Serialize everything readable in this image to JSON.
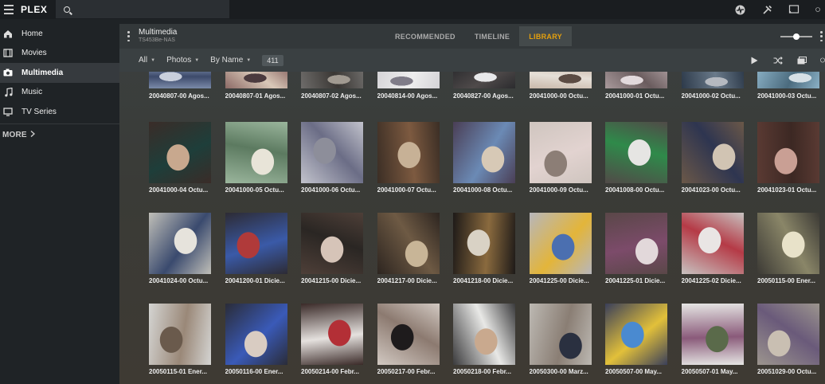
{
  "app": {
    "logo_text": "PLEX",
    "brand_color": "#e5a00d"
  },
  "sidebar": {
    "items": [
      {
        "label": "Home",
        "icon": "home-icon"
      },
      {
        "label": "Movies",
        "icon": "film-icon"
      },
      {
        "label": "Multimedia",
        "icon": "camera-icon",
        "active": true
      },
      {
        "label": "Music",
        "icon": "music-note-icon"
      },
      {
        "label": "TV Series",
        "icon": "tv-icon"
      }
    ],
    "more_label": "MORE"
  },
  "header": {
    "library_title": "Multimedia",
    "library_subtitle": "TS453Be-NAS",
    "tabs": [
      {
        "label": "RECOMMENDED"
      },
      {
        "label": "TIMELINE"
      },
      {
        "label": "LIBRARY",
        "active": true
      }
    ]
  },
  "filters": {
    "type": "All",
    "media": "Photos",
    "sort": "By Name",
    "count": "411"
  },
  "tiles": [
    {
      "caption": "20040807-00 Agos...",
      "colors": [
        "#7a8aa8",
        "#c9cfdc",
        "#3d4a6b"
      ]
    },
    {
      "caption": "20040807-01 Agos...",
      "colors": [
        "#8c6a66",
        "#4b3a3e",
        "#d9c8b8"
      ]
    },
    {
      "caption": "20040807-02 Agos...",
      "colors": [
        "#6e6c6a",
        "#a19a91",
        "#3a3734"
      ]
    },
    {
      "caption": "20040814-00 Agos...",
      "colors": [
        "#d4d3d6",
        "#7f7c88",
        "#eeeeee"
      ]
    },
    {
      "caption": "20040827-00 Agos...",
      "colors": [
        "#2b2b2e",
        "#e8e8ea",
        "#4f4a4a"
      ]
    },
    {
      "caption": "20041000-00 Octu...",
      "colors": [
        "#c9b8aa",
        "#5b4b43",
        "#e5dfd7"
      ]
    },
    {
      "caption": "20041000-01 Octu...",
      "colors": [
        "#a99a9c",
        "#e2d9dc",
        "#6a5c5e"
      ]
    },
    {
      "caption": "20041000-02 Octu...",
      "colors": [
        "#2d3a4a",
        "#b5b9c0",
        "#6a7a8a"
      ]
    },
    {
      "caption": "20041000-03 Octu...",
      "colors": [
        "#8ab0c5",
        "#d6e0e6",
        "#4b6b7e"
      ]
    },
    {
      "caption": "20041000-04 Octu...",
      "colors": [
        "#3a2c28",
        "#c8a88e",
        "#1e3e3a"
      ]
    },
    {
      "caption": "20041000-05 Octu...",
      "colors": [
        "#9ab59c",
        "#e8e4d8",
        "#5c7a60"
      ]
    },
    {
      "caption": "20041000-06 Octu...",
      "colors": [
        "#c2c3cc",
        "#8d8e9a",
        "#6b6d86"
      ]
    },
    {
      "caption": "20041000-07 Octu...",
      "colors": [
        "#3b2e25",
        "#c7b196",
        "#7d5a40"
      ]
    },
    {
      "caption": "20041000-08 Octu...",
      "colors": [
        "#4a3e55",
        "#d7c9b6",
        "#6b8ab5"
      ]
    },
    {
      "caption": "20041000-09 Octu...",
      "colors": [
        "#cfc5bf",
        "#8c7e76",
        "#e2d3d0"
      ]
    },
    {
      "caption": "20041008-00 Octu...",
      "colors": [
        "#514a48",
        "#e6e5e3",
        "#2f8a4a"
      ]
    },
    {
      "caption": "20041023-00 Octu...",
      "colors": [
        "#6b5848",
        "#d1c4b3",
        "#2e3550"
      ]
    },
    {
      "caption": "20041023-01 Octu...",
      "colors": [
        "#5a3a33",
        "#c99f94",
        "#3c2823"
      ]
    },
    {
      "caption": "20041024-00 Octu...",
      "colors": [
        "#c0bfb8",
        "#e6e3dc",
        "#3a4a6e"
      ]
    },
    {
      "caption": "20041200-01 Dicie...",
      "colors": [
        "#2d2b34",
        "#b03a3a",
        "#3a5aa8"
      ]
    },
    {
      "caption": "20041215-00 Dicie...",
      "colors": [
        "#4e3f38",
        "#d6c4b8",
        "#2a2623"
      ]
    },
    {
      "caption": "20041217-00 Dicie...",
      "colors": [
        "#2d2520",
        "#c8b597",
        "#6e5a44"
      ]
    },
    {
      "caption": "20041218-00 Dicie...",
      "colors": [
        "#1e1a18",
        "#d9d2c5",
        "#8a6a3e"
      ]
    },
    {
      "caption": "20041225-00 Dicie...",
      "colors": [
        "#b7b6bb",
        "#4b6fb0",
        "#e3b53a"
      ]
    },
    {
      "caption": "20041225-01 Dicie...",
      "colors": [
        "#5a4748",
        "#e2d8da",
        "#7c4b6a"
      ]
    },
    {
      "caption": "20041225-02 Dicie...",
      "colors": [
        "#c7c2c0",
        "#e9e5e4",
        "#b53a46"
      ]
    },
    {
      "caption": "20050115-00 Ener...",
      "colors": [
        "#3c3a35",
        "#e8e2c9",
        "#8a8668"
      ]
    },
    {
      "caption": "20050115-01 Ener...",
      "colors": [
        "#d4d4d2",
        "#6a5a4c",
        "#9a8878"
      ]
    },
    {
      "caption": "20050116-00 Ener...",
      "colors": [
        "#2a2c38",
        "#d9ccc2",
        "#3a5ab8"
      ]
    },
    {
      "caption": "20050214-00 Febr...",
      "colors": [
        "#3a2a28",
        "#b32f36",
        "#e5e1de"
      ]
    },
    {
      "caption": "20050217-00 Febr...",
      "colors": [
        "#d2c9c2",
        "#1e1b1c",
        "#8c7a70"
      ]
    },
    {
      "caption": "20050218-00 Febr...",
      "colors": [
        "#3a3a3c",
        "#c9a98e",
        "#e8e8e6"
      ]
    },
    {
      "caption": "20050300-00 Marz...",
      "colors": [
        "#bcb8b2",
        "#2a3040",
        "#8a7e74"
      ]
    },
    {
      "caption": "20050507-00 May...",
      "colors": [
        "#3a3f5a",
        "#4a8ad0",
        "#e2c03a"
      ]
    },
    {
      "caption": "20050507-01 May...",
      "colors": [
        "#e6e6e4",
        "#5a6a4a",
        "#8a5a7a"
      ]
    },
    {
      "caption": "20051029-00 Octu...",
      "colors": [
        "#9c958e",
        "#c9bfb2",
        "#6a5a7a"
      ]
    }
  ]
}
